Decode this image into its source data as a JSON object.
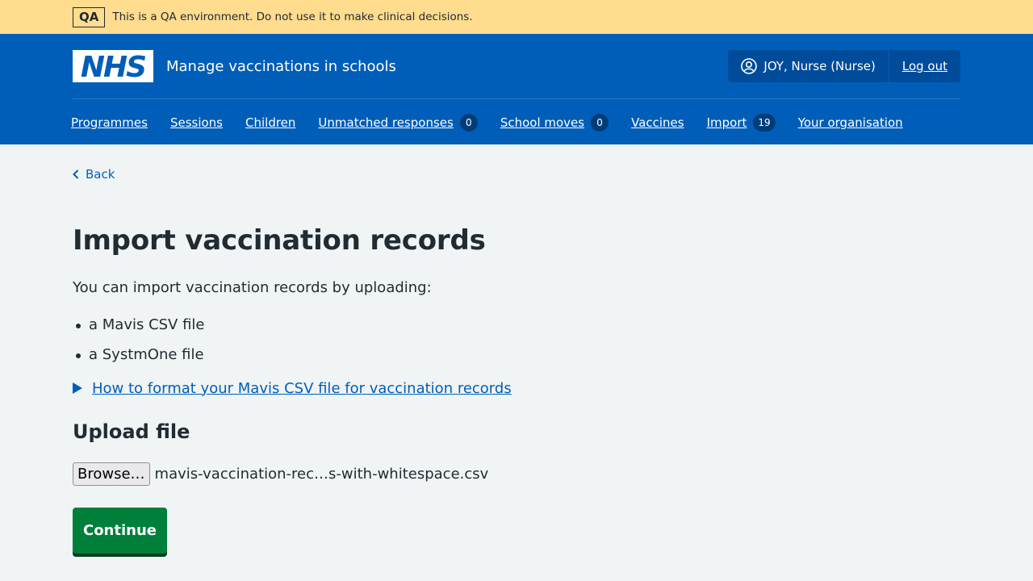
{
  "qa_banner": {
    "tag": "QA",
    "message": "This is a QA environment. Do not use it to make clinical decisions."
  },
  "header": {
    "logo_text": "NHS",
    "service_name": "Manage vaccinations in schools",
    "account": {
      "user": "JOY, Nurse (Nurse)",
      "logout_label": "Log out"
    }
  },
  "nav": {
    "items": [
      {
        "label": "Programmes"
      },
      {
        "label": "Sessions"
      },
      {
        "label": "Children"
      },
      {
        "label": "Unmatched responses",
        "count": "0"
      },
      {
        "label": "School moves",
        "count": "0"
      },
      {
        "label": "Vaccines"
      },
      {
        "label": "Import",
        "count": "19"
      },
      {
        "label": "Your organisation"
      }
    ]
  },
  "main": {
    "back_label": "Back",
    "title": "Import vaccination records",
    "intro": "You can import vaccination records by uploading:",
    "bullets": [
      "a Mavis CSV file",
      "a SystmOne file"
    ],
    "details_summary": "How to format your Mavis CSV file for vaccination records",
    "upload_heading": "Upload file",
    "browse_label": "Browse…",
    "selected_file": "mavis-vaccination-rec…s-with-whitespace.csv",
    "continue_label": "Continue"
  },
  "colors": {
    "nhs_blue": "#005eb8",
    "qa_banner": "#ffdc8e",
    "page_bg": "#f0f4f5",
    "button_green": "#007f3b"
  }
}
